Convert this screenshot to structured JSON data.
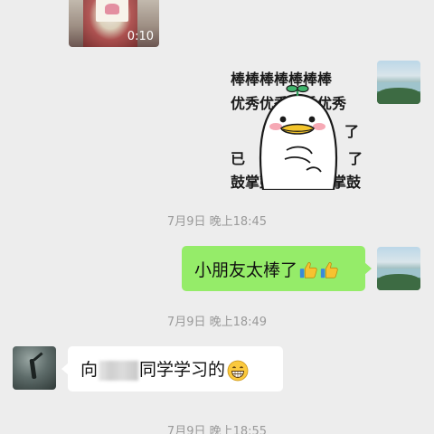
{
  "video": {
    "duration": "0:10"
  },
  "sticker": {
    "rows": [
      "棒棒棒棒棒棒棒",
      "优秀优秀优秀优秀",
      "了",
      "已",
      "了",
      "鼓掌鼓掌鼓掌鼓掌鼓"
    ],
    "emoji": "duck-sticker"
  },
  "timestamps": [
    "7月9日 晚上18:45",
    "7月9日 晚上18:49",
    "7月9日 晚上18:55"
  ],
  "messages": {
    "mine": {
      "text": "小朋友太棒了",
      "emoji": "thumbs-up-icon"
    },
    "friend": {
      "text_before": "向",
      "text_after": "同学学习的",
      "emoji": "grinning-face-icon"
    }
  },
  "colors": {
    "background": "#ededed",
    "my_bubble": "#95ec69",
    "friend_bubble": "#ffffff",
    "timestamp": "#9a9a9a"
  }
}
